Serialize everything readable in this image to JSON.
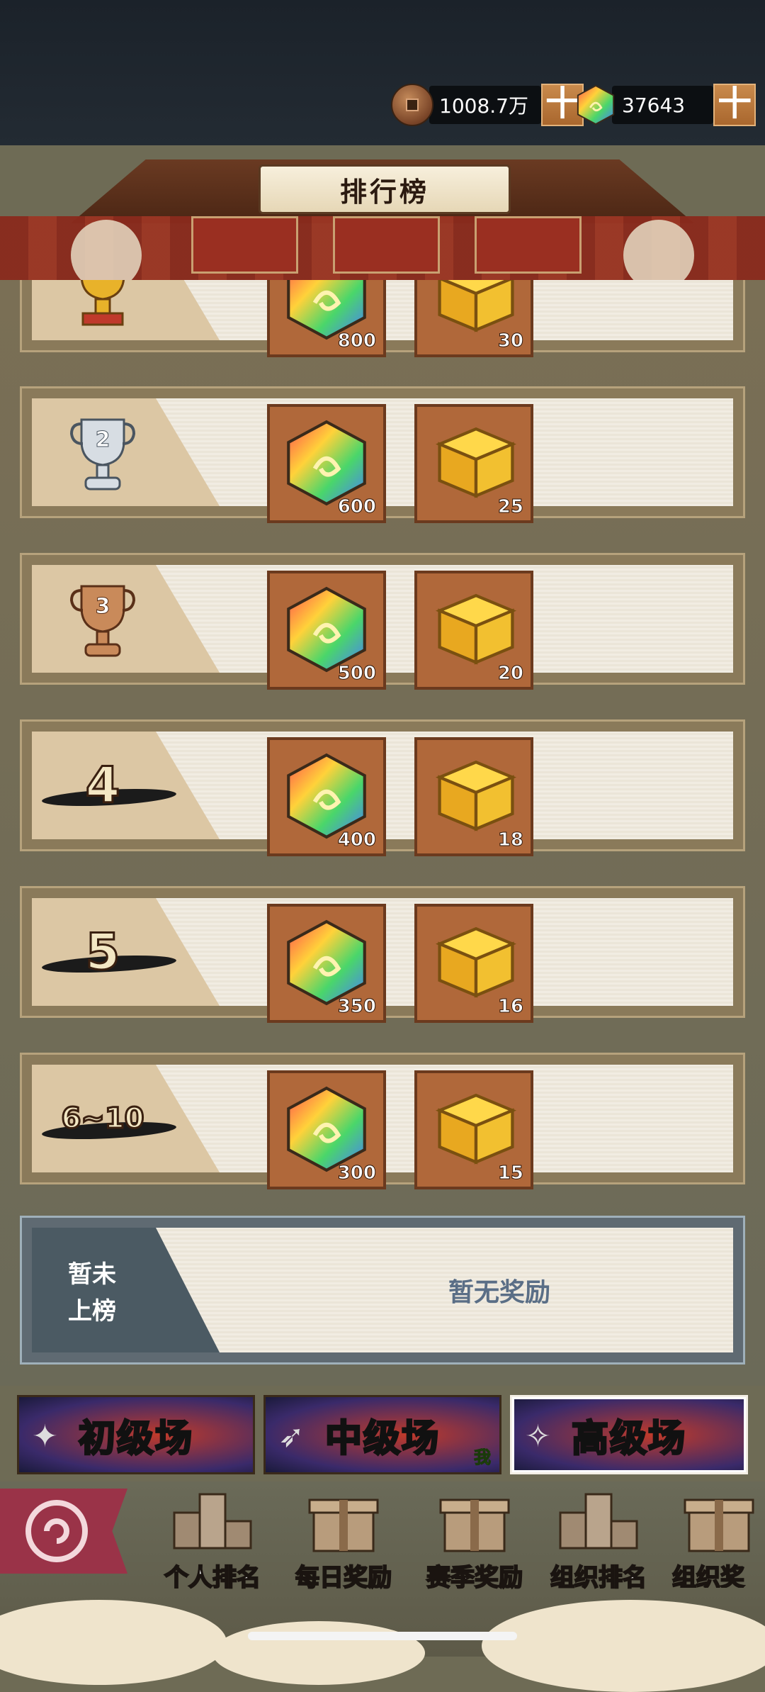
{
  "currencies": [
    {
      "icon": "copper-coin-icon",
      "value": "1008.7万"
    },
    {
      "icon": "rainbow-gem-icon",
      "value": "37643"
    }
  ],
  "plus_label": "十",
  "title": "排行榜",
  "rows": [
    {
      "rank": "1",
      "trophy": "gold-trophy-icon",
      "gems": "800",
      "chests": "30"
    },
    {
      "rank": "2",
      "trophy": "silver-trophy-icon",
      "gems": "600",
      "chests": "25"
    },
    {
      "rank": "3",
      "trophy": "bronze-trophy-icon",
      "gems": "500",
      "chests": "20"
    },
    {
      "rank": "4",
      "gems": "400",
      "chests": "18"
    },
    {
      "rank": "5",
      "gems": "350",
      "chests": "16"
    },
    {
      "rank": "6~10",
      "gems": "300",
      "chests": "15"
    }
  ],
  "own_rank": {
    "label_line1": "暂未",
    "label_line2": "上榜",
    "reward": "暂无奖励"
  },
  "tabs": [
    {
      "label": "初级场",
      "active": false
    },
    {
      "label": "中级场",
      "active": false,
      "badge": "我"
    },
    {
      "label": "高级场",
      "active": true
    }
  ],
  "bottom_nav": [
    {
      "label": "个人排名",
      "icon": "podium-icon"
    },
    {
      "label": "每日奖励",
      "icon": "gift-box-icon"
    },
    {
      "label": "赛季奖励",
      "icon": "gift-box-icon"
    },
    {
      "label": "组织排名",
      "icon": "podium-icon"
    },
    {
      "label": "组织奖",
      "icon": "gift-box-icon"
    }
  ],
  "colors": {
    "accent": "#b0683a",
    "tab_active_border": "#f4efe6",
    "no_reward_text": "#5a6e86"
  }
}
